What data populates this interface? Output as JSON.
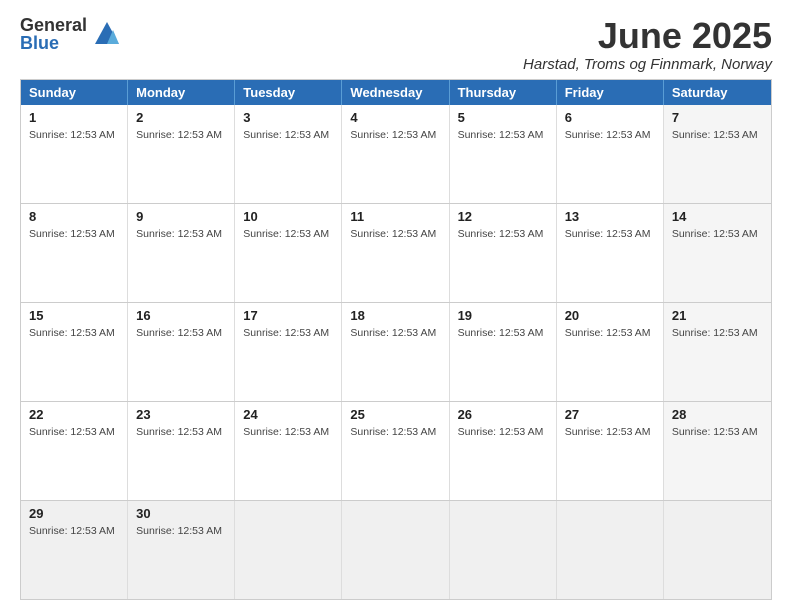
{
  "logo": {
    "general": "General",
    "blue": "Blue"
  },
  "header": {
    "month_title": "June 2025",
    "location": "Harstad, Troms og Finnmark, Norway"
  },
  "weekdays": [
    "Sunday",
    "Monday",
    "Tuesday",
    "Wednesday",
    "Thursday",
    "Friday",
    "Saturday"
  ],
  "sunrise_text": "Sunrise: 12:53 AM",
  "weeks": [
    [
      {
        "day": "1",
        "sunrise": "Sunrise: 12:53 AM",
        "empty": false,
        "saturday": false
      },
      {
        "day": "2",
        "sunrise": "Sunrise: 12:53 AM",
        "empty": false,
        "saturday": false
      },
      {
        "day": "3",
        "sunrise": "Sunrise: 12:53 AM",
        "empty": false,
        "saturday": false
      },
      {
        "day": "4",
        "sunrise": "Sunrise: 12:53 AM",
        "empty": false,
        "saturday": false
      },
      {
        "day": "5",
        "sunrise": "Sunrise: 12:53 AM",
        "empty": false,
        "saturday": false
      },
      {
        "day": "6",
        "sunrise": "Sunrise: 12:53 AM",
        "empty": false,
        "saturday": false
      },
      {
        "day": "7",
        "sunrise": "Sunrise: 12:53 AM",
        "empty": false,
        "saturday": true
      }
    ],
    [
      {
        "day": "8",
        "sunrise": "Sunrise: 12:53 AM",
        "empty": false,
        "saturday": false
      },
      {
        "day": "9",
        "sunrise": "Sunrise: 12:53 AM",
        "empty": false,
        "saturday": false
      },
      {
        "day": "10",
        "sunrise": "Sunrise: 12:53 AM",
        "empty": false,
        "saturday": false
      },
      {
        "day": "11",
        "sunrise": "Sunrise: 12:53 AM",
        "empty": false,
        "saturday": false
      },
      {
        "day": "12",
        "sunrise": "Sunrise: 12:53 AM",
        "empty": false,
        "saturday": false
      },
      {
        "day": "13",
        "sunrise": "Sunrise: 12:53 AM",
        "empty": false,
        "saturday": false
      },
      {
        "day": "14",
        "sunrise": "Sunrise: 12:53 AM",
        "empty": false,
        "saturday": true
      }
    ],
    [
      {
        "day": "15",
        "sunrise": "Sunrise: 12:53 AM",
        "empty": false,
        "saturday": false
      },
      {
        "day": "16",
        "sunrise": "Sunrise: 12:53 AM",
        "empty": false,
        "saturday": false
      },
      {
        "day": "17",
        "sunrise": "Sunrise: 12:53 AM",
        "empty": false,
        "saturday": false
      },
      {
        "day": "18",
        "sunrise": "Sunrise: 12:53 AM",
        "empty": false,
        "saturday": false
      },
      {
        "day": "19",
        "sunrise": "Sunrise: 12:53 AM",
        "empty": false,
        "saturday": false
      },
      {
        "day": "20",
        "sunrise": "Sunrise: 12:53 AM",
        "empty": false,
        "saturday": false
      },
      {
        "day": "21",
        "sunrise": "Sunrise: 12:53 AM",
        "empty": false,
        "saturday": true
      }
    ],
    [
      {
        "day": "22",
        "sunrise": "Sunrise: 12:53 AM",
        "empty": false,
        "saturday": false
      },
      {
        "day": "23",
        "sunrise": "Sunrise: 12:53 AM",
        "empty": false,
        "saturday": false
      },
      {
        "day": "24",
        "sunrise": "Sunrise: 12:53 AM",
        "empty": false,
        "saturday": false
      },
      {
        "day": "25",
        "sunrise": "Sunrise: 12:53 AM",
        "empty": false,
        "saturday": false
      },
      {
        "day": "26",
        "sunrise": "Sunrise: 12:53 AM",
        "empty": false,
        "saturday": false
      },
      {
        "day": "27",
        "sunrise": "Sunrise: 12:53 AM",
        "empty": false,
        "saturday": false
      },
      {
        "day": "28",
        "sunrise": "Sunrise: 12:53 AM",
        "empty": false,
        "saturday": true
      }
    ],
    [
      {
        "day": "29",
        "sunrise": "Sunrise: 12:53 AM",
        "empty": false,
        "saturday": false
      },
      {
        "day": "30",
        "sunrise": "Sunrise: 12:53 AM",
        "empty": false,
        "saturday": false
      },
      {
        "day": "",
        "sunrise": "",
        "empty": true,
        "saturday": false
      },
      {
        "day": "",
        "sunrise": "",
        "empty": true,
        "saturday": false
      },
      {
        "day": "",
        "sunrise": "",
        "empty": true,
        "saturday": false
      },
      {
        "day": "",
        "sunrise": "",
        "empty": true,
        "saturday": false
      },
      {
        "day": "",
        "sunrise": "",
        "empty": true,
        "saturday": true
      }
    ]
  ]
}
